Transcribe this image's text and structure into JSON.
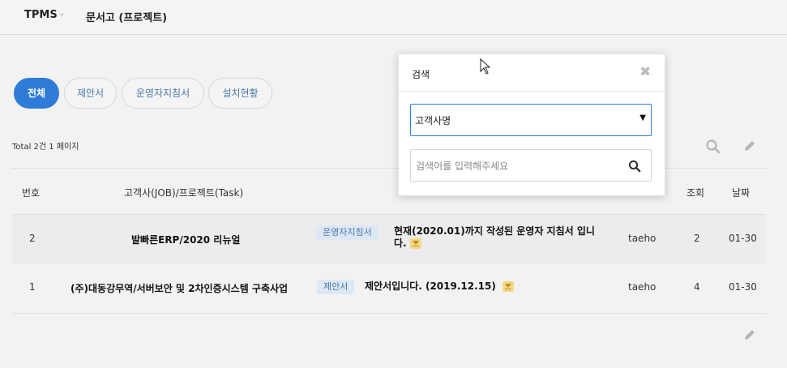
{
  "header": {
    "brand": "TPMS",
    "brand_caret": "⌄",
    "page_title": "문서고 (프로젝트)"
  },
  "tabs": [
    {
      "label": "전체",
      "active": true
    },
    {
      "label": "제안서",
      "active": false
    },
    {
      "label": "운영자지침서",
      "active": false
    },
    {
      "label": "설치현황",
      "active": false
    }
  ],
  "summary": "Total 2건 1 페이지",
  "table": {
    "headers": {
      "no": "번호",
      "project": "고객사(JOB)/프로젝트(Task)",
      "views": "조회",
      "date": "날짜"
    },
    "rows": [
      {
        "no": "2",
        "project": "발빠른ERP/2020 리뉴얼",
        "category": "운영자지침서",
        "description_line1": "현재(2020.01)까지 작성된 운영자 지침서 입니",
        "description_line2": "다.",
        "author": "taeho",
        "views": "2",
        "date": "01-30"
      },
      {
        "no": "1",
        "project": "(주)대동강무역/서버보안 및 2차인증시스템 구축사업",
        "category": "제안서",
        "description_line1": "제안서입니다. (2019.12.15)",
        "description_line2": "",
        "author": "taeho",
        "views": "4",
        "date": "01-30"
      }
    ]
  },
  "search_popup": {
    "title": "검색",
    "close": "✖",
    "field_select": {
      "selected": "고객사명",
      "caret": "▼"
    },
    "search_input": {
      "value": "",
      "placeholder": "검색어를 입력해주세요"
    }
  },
  "colors": {
    "accent": "#2f7cd8",
    "badge_bg": "#dde8f5",
    "badge_text": "#4a78a8",
    "attachment": "#f2d98a"
  },
  "icons": {
    "toolbar_search": "search-icon",
    "toolbar_write": "pencil-icon",
    "bottom_write": "pencil-icon",
    "attachment": "download-icon"
  }
}
